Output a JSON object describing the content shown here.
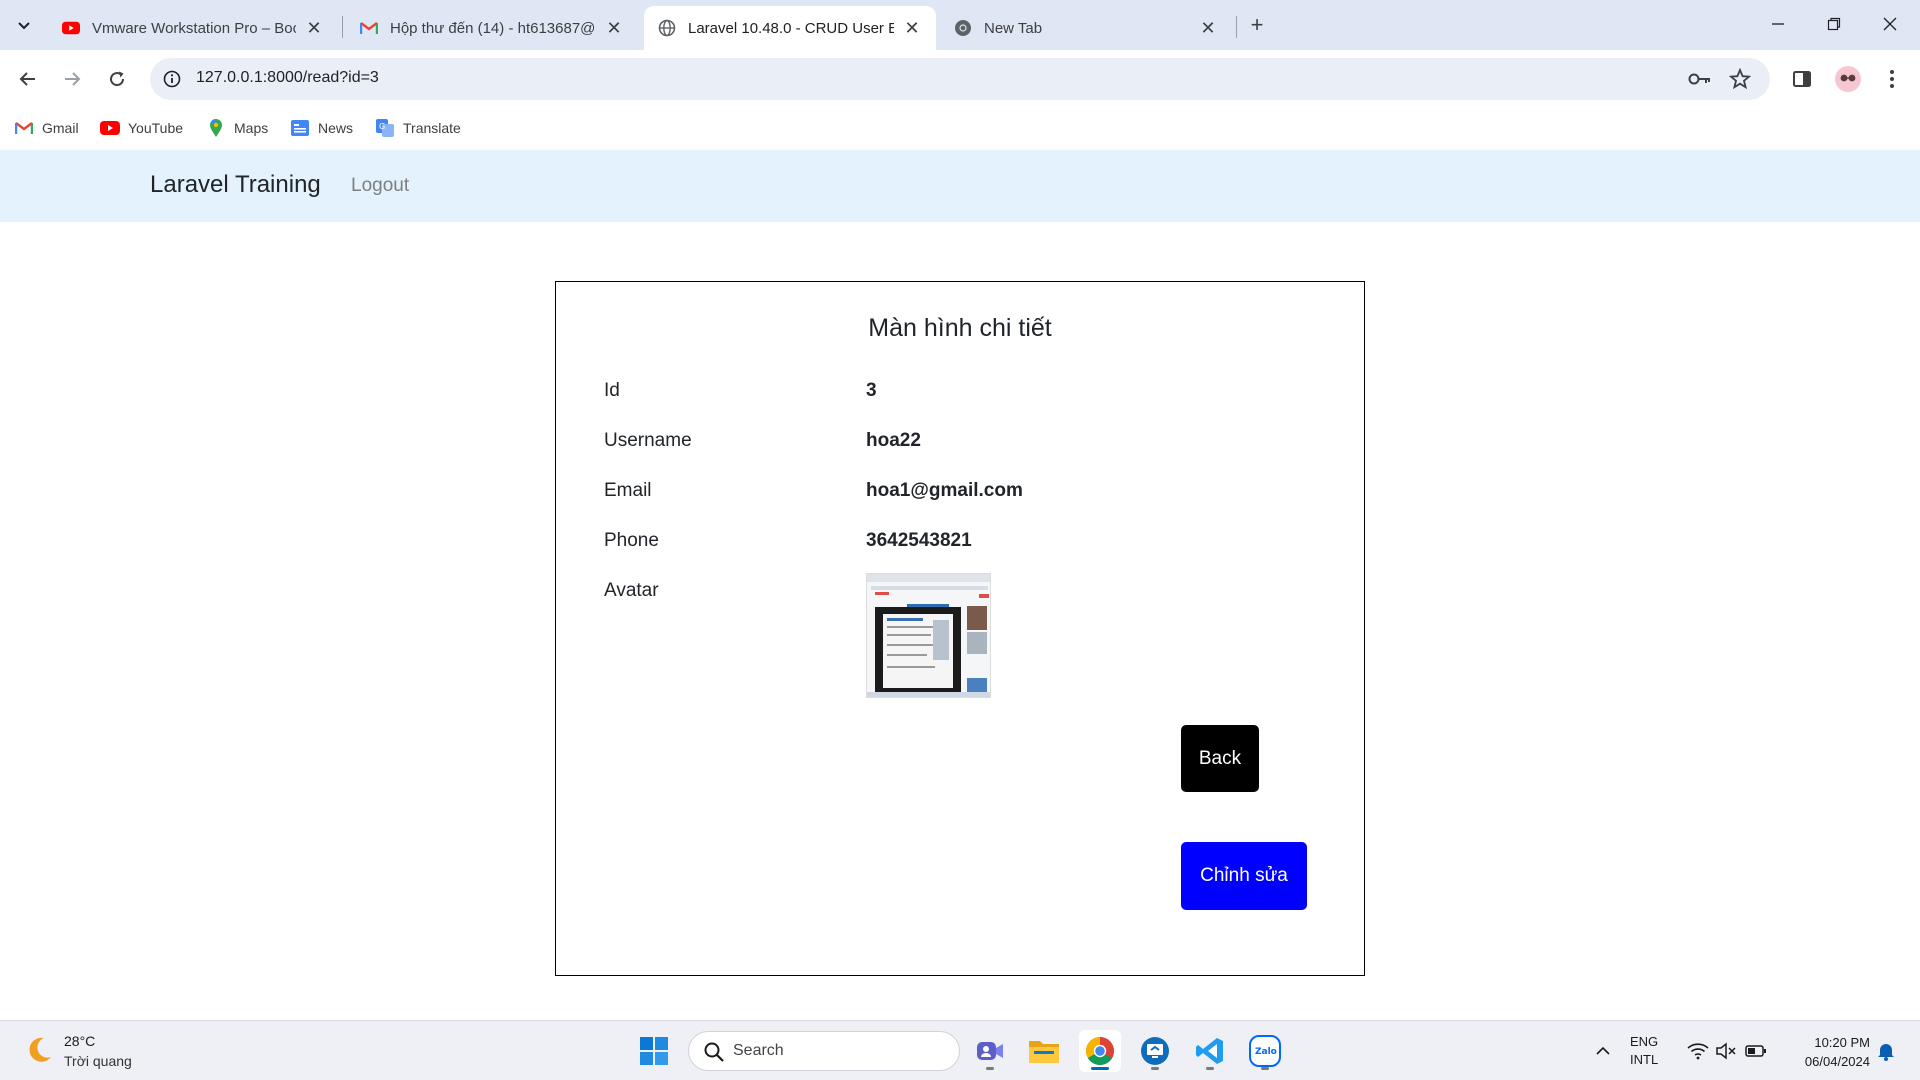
{
  "browser": {
    "tabs": [
      {
        "title": "Vmware Workstation Pro – Boo",
        "icon": "youtube-icon",
        "active": false
      },
      {
        "title": "Hộp thư đến (14) - ht613687@",
        "icon": "gmail-icon",
        "active": false
      },
      {
        "title": "Laravel 10.48.0 - CRUD User Ex",
        "icon": "globe-icon",
        "active": true
      },
      {
        "title": "New Tab",
        "icon": "chrome-icon",
        "active": false
      }
    ],
    "url": "127.0.0.1:8000/read?id=3",
    "bookmarks": [
      "Gmail",
      "YouTube",
      "Maps",
      "News",
      "Translate"
    ]
  },
  "navbar": {
    "brand": "Laravel Training",
    "logout": "Logout"
  },
  "detail": {
    "title": "Màn hình chi tiết",
    "fields": [
      {
        "label": "Id",
        "value": "3"
      },
      {
        "label": "Username",
        "value": "hoa22"
      },
      {
        "label": "Email",
        "value": "hoa1@gmail.com"
      },
      {
        "label": "Phone",
        "value": "3642543821"
      },
      {
        "label": "Avatar",
        "value": ""
      }
    ],
    "back_label": "Back",
    "edit_label": "Chỉnh sửa"
  },
  "taskbar": {
    "weather_temp": "28°C",
    "weather_desc": "Trời quang",
    "search_placeholder": "Search",
    "lang_line1": "ENG",
    "lang_line2": "INTL",
    "time": "10:20 PM",
    "date": "06/04/2024"
  },
  "colors": {
    "tabstrip": "#dfe7f5",
    "navbar_bg": "#e3f2fd",
    "edit_button": "#0000ff",
    "back_button": "#000000"
  }
}
